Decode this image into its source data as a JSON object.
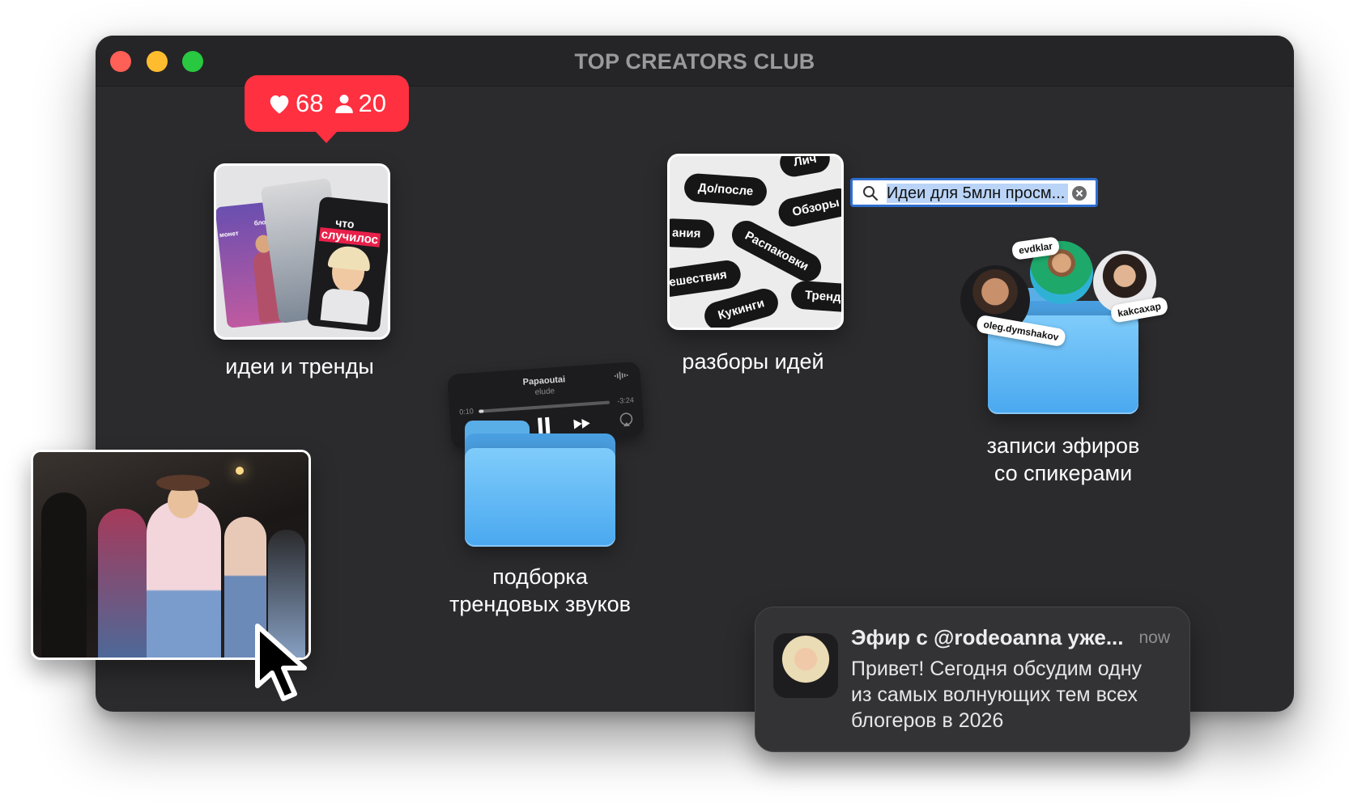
{
  "window": {
    "title": "TOP CREATORS CLUB"
  },
  "badge": {
    "likes": "68",
    "followers": "20"
  },
  "folders": {
    "ideas": {
      "label": "идеи и тренды"
    },
    "breakdowns": {
      "label": "разборы идей"
    },
    "sounds": {
      "label_line1": "подборка",
      "label_line2": "трендовых звуков"
    },
    "streams": {
      "label_line1": "записи эфиров",
      "label_line2": "со спикерами"
    }
  },
  "ideas_thumb": {
    "text1": "что",
    "text2": "случилос",
    "tag1": "блондин",
    "tag2": "монет"
  },
  "breakdown_pills": [
    "До/после",
    "Обзоры",
    "ания",
    "Распаковки",
    "ешествия",
    "Тренд",
    "Кукинги",
    "Лич"
  ],
  "search": {
    "value": "Идеи для 5млн просм..."
  },
  "player": {
    "track": "Papaoutai",
    "artist": "elude",
    "elapsed": "0:10",
    "remaining": "-3:24"
  },
  "speaker_tags": [
    "evdklar",
    "oleg.dymshakov",
    "kakcaxap"
  ],
  "notification": {
    "title": "Эфир с @rodeoanna уже...",
    "time": "now",
    "body": "Привет! Сегодня обсудим одну из самых волнующих тем всех блогеров в 2026"
  }
}
